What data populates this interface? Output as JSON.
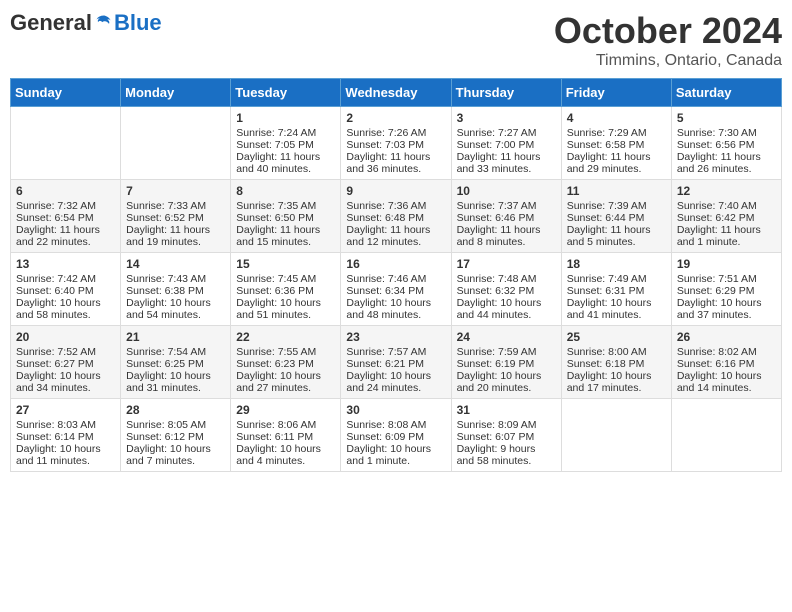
{
  "header": {
    "logo_general": "General",
    "logo_blue": "Blue",
    "month_title": "October 2024",
    "location": "Timmins, Ontario, Canada"
  },
  "days_of_week": [
    "Sunday",
    "Monday",
    "Tuesday",
    "Wednesday",
    "Thursday",
    "Friday",
    "Saturday"
  ],
  "weeks": [
    [
      {
        "day": "",
        "sunrise": "",
        "sunset": "",
        "daylight": ""
      },
      {
        "day": "",
        "sunrise": "",
        "sunset": "",
        "daylight": ""
      },
      {
        "day": "1",
        "sunrise": "Sunrise: 7:24 AM",
        "sunset": "Sunset: 7:05 PM",
        "daylight": "Daylight: 11 hours and 40 minutes."
      },
      {
        "day": "2",
        "sunrise": "Sunrise: 7:26 AM",
        "sunset": "Sunset: 7:03 PM",
        "daylight": "Daylight: 11 hours and 36 minutes."
      },
      {
        "day": "3",
        "sunrise": "Sunrise: 7:27 AM",
        "sunset": "Sunset: 7:00 PM",
        "daylight": "Daylight: 11 hours and 33 minutes."
      },
      {
        "day": "4",
        "sunrise": "Sunrise: 7:29 AM",
        "sunset": "Sunset: 6:58 PM",
        "daylight": "Daylight: 11 hours and 29 minutes."
      },
      {
        "day": "5",
        "sunrise": "Sunrise: 7:30 AM",
        "sunset": "Sunset: 6:56 PM",
        "daylight": "Daylight: 11 hours and 26 minutes."
      }
    ],
    [
      {
        "day": "6",
        "sunrise": "Sunrise: 7:32 AM",
        "sunset": "Sunset: 6:54 PM",
        "daylight": "Daylight: 11 hours and 22 minutes."
      },
      {
        "day": "7",
        "sunrise": "Sunrise: 7:33 AM",
        "sunset": "Sunset: 6:52 PM",
        "daylight": "Daylight: 11 hours and 19 minutes."
      },
      {
        "day": "8",
        "sunrise": "Sunrise: 7:35 AM",
        "sunset": "Sunset: 6:50 PM",
        "daylight": "Daylight: 11 hours and 15 minutes."
      },
      {
        "day": "9",
        "sunrise": "Sunrise: 7:36 AM",
        "sunset": "Sunset: 6:48 PM",
        "daylight": "Daylight: 11 hours and 12 minutes."
      },
      {
        "day": "10",
        "sunrise": "Sunrise: 7:37 AM",
        "sunset": "Sunset: 6:46 PM",
        "daylight": "Daylight: 11 hours and 8 minutes."
      },
      {
        "day": "11",
        "sunrise": "Sunrise: 7:39 AM",
        "sunset": "Sunset: 6:44 PM",
        "daylight": "Daylight: 11 hours and 5 minutes."
      },
      {
        "day": "12",
        "sunrise": "Sunrise: 7:40 AM",
        "sunset": "Sunset: 6:42 PM",
        "daylight": "Daylight: 11 hours and 1 minute."
      }
    ],
    [
      {
        "day": "13",
        "sunrise": "Sunrise: 7:42 AM",
        "sunset": "Sunset: 6:40 PM",
        "daylight": "Daylight: 10 hours and 58 minutes."
      },
      {
        "day": "14",
        "sunrise": "Sunrise: 7:43 AM",
        "sunset": "Sunset: 6:38 PM",
        "daylight": "Daylight: 10 hours and 54 minutes."
      },
      {
        "day": "15",
        "sunrise": "Sunrise: 7:45 AM",
        "sunset": "Sunset: 6:36 PM",
        "daylight": "Daylight: 10 hours and 51 minutes."
      },
      {
        "day": "16",
        "sunrise": "Sunrise: 7:46 AM",
        "sunset": "Sunset: 6:34 PM",
        "daylight": "Daylight: 10 hours and 48 minutes."
      },
      {
        "day": "17",
        "sunrise": "Sunrise: 7:48 AM",
        "sunset": "Sunset: 6:32 PM",
        "daylight": "Daylight: 10 hours and 44 minutes."
      },
      {
        "day": "18",
        "sunrise": "Sunrise: 7:49 AM",
        "sunset": "Sunset: 6:31 PM",
        "daylight": "Daylight: 10 hours and 41 minutes."
      },
      {
        "day": "19",
        "sunrise": "Sunrise: 7:51 AM",
        "sunset": "Sunset: 6:29 PM",
        "daylight": "Daylight: 10 hours and 37 minutes."
      }
    ],
    [
      {
        "day": "20",
        "sunrise": "Sunrise: 7:52 AM",
        "sunset": "Sunset: 6:27 PM",
        "daylight": "Daylight: 10 hours and 34 minutes."
      },
      {
        "day": "21",
        "sunrise": "Sunrise: 7:54 AM",
        "sunset": "Sunset: 6:25 PM",
        "daylight": "Daylight: 10 hours and 31 minutes."
      },
      {
        "day": "22",
        "sunrise": "Sunrise: 7:55 AM",
        "sunset": "Sunset: 6:23 PM",
        "daylight": "Daylight: 10 hours and 27 minutes."
      },
      {
        "day": "23",
        "sunrise": "Sunrise: 7:57 AM",
        "sunset": "Sunset: 6:21 PM",
        "daylight": "Daylight: 10 hours and 24 minutes."
      },
      {
        "day": "24",
        "sunrise": "Sunrise: 7:59 AM",
        "sunset": "Sunset: 6:19 PM",
        "daylight": "Daylight: 10 hours and 20 minutes."
      },
      {
        "day": "25",
        "sunrise": "Sunrise: 8:00 AM",
        "sunset": "Sunset: 6:18 PM",
        "daylight": "Daylight: 10 hours and 17 minutes."
      },
      {
        "day": "26",
        "sunrise": "Sunrise: 8:02 AM",
        "sunset": "Sunset: 6:16 PM",
        "daylight": "Daylight: 10 hours and 14 minutes."
      }
    ],
    [
      {
        "day": "27",
        "sunrise": "Sunrise: 8:03 AM",
        "sunset": "Sunset: 6:14 PM",
        "daylight": "Daylight: 10 hours and 11 minutes."
      },
      {
        "day": "28",
        "sunrise": "Sunrise: 8:05 AM",
        "sunset": "Sunset: 6:12 PM",
        "daylight": "Daylight: 10 hours and 7 minutes."
      },
      {
        "day": "29",
        "sunrise": "Sunrise: 8:06 AM",
        "sunset": "Sunset: 6:11 PM",
        "daylight": "Daylight: 10 hours and 4 minutes."
      },
      {
        "day": "30",
        "sunrise": "Sunrise: 8:08 AM",
        "sunset": "Sunset: 6:09 PM",
        "daylight": "Daylight: 10 hours and 1 minute."
      },
      {
        "day": "31",
        "sunrise": "Sunrise: 8:09 AM",
        "sunset": "Sunset: 6:07 PM",
        "daylight": "Daylight: 9 hours and 58 minutes."
      },
      {
        "day": "",
        "sunrise": "",
        "sunset": "",
        "daylight": ""
      },
      {
        "day": "",
        "sunrise": "",
        "sunset": "",
        "daylight": ""
      }
    ]
  ]
}
